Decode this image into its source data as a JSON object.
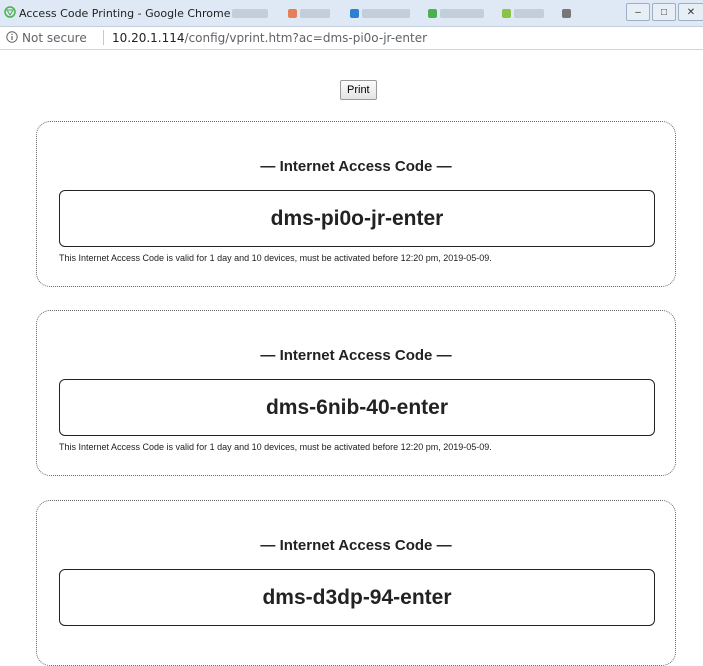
{
  "window": {
    "title": "Access Code Printing - Google Chrome",
    "controls": {
      "minimize": "–",
      "maximize": "□",
      "close": "✕"
    }
  },
  "address_bar": {
    "security_label": "Not secure",
    "url_host": "10.20.1.114",
    "url_path": "/config/vprint.htm?ac=dms-pi0o-jr-enter"
  },
  "page": {
    "print_button": "Print",
    "cards": [
      {
        "heading": "— Internet Access Code —",
        "code": "dms-pi0o-jr-enter",
        "validity": "This Internet Access Code is valid for 1 day and 10 devices, must be activated before 12:20 pm, 2019-05-09."
      },
      {
        "heading": "— Internet Access Code —",
        "code": "dms-6nib-40-enter",
        "validity": "This Internet Access Code is valid for 1 day and 10 devices, must be activated before 12:20 pm, 2019-05-09."
      },
      {
        "heading": "— Internet Access Code —",
        "code": "dms-d3dp-94-enter",
        "validity": ""
      }
    ]
  },
  "colors": {
    "titlebar": "#dfe9f5",
    "card_border": "#666666",
    "text": "#222222"
  }
}
